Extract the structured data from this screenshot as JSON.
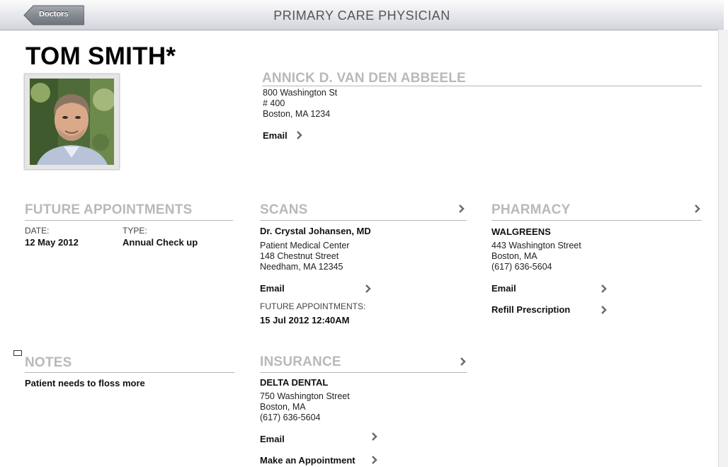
{
  "navbar": {
    "title": "PRIMARY CARE PHYSICIAN",
    "back_label": "Doctors"
  },
  "patient": {
    "name": "TOM SMITH*"
  },
  "physician": {
    "name": "ANNICK D. VAN DEN ABBEELE",
    "address": [
      "800 Washington St",
      "# 400",
      "Boston, MA 1234"
    ],
    "email_label": "Email"
  },
  "future_appointments": {
    "title": "FUTURE APPOINTMENTS",
    "date_label": "DATE:",
    "date_value": "12 May 2012",
    "type_label": "TYPE:",
    "type_value": "Annual Check up"
  },
  "scans": {
    "title": "SCANS",
    "doctor": "Dr. Crystal Johansen, MD",
    "address": [
      "Patient Medical Center",
      "148 Chestnut Street",
      "Needham, MA 12345"
    ],
    "email_label": "Email",
    "appointments_label": "FUTURE APPOINTMENTS:",
    "appointments_value": "15 Jul 2012  12:40AM"
  },
  "pharmacy": {
    "title": "PHARMACY",
    "name": "WALGREENS",
    "address": [
      "443 Washington Street",
      "Boston, MA",
      "(617) 636-5604"
    ],
    "email_label": "Email",
    "refill_label": "Refill Prescription"
  },
  "notes": {
    "title": "NOTES",
    "text": "Patient needs to floss more"
  },
  "insurance": {
    "title": "INSURANCE",
    "name": "DELTA DENTAL",
    "address": [
      "750 Washington Street",
      "Boston, MA",
      "(617) 636-5604"
    ],
    "email_label": "Email",
    "appointment_label": "Make an Appointment"
  },
  "colors": {
    "section_title": "#b9b9b9",
    "navbar_back": "#8a8e96"
  }
}
